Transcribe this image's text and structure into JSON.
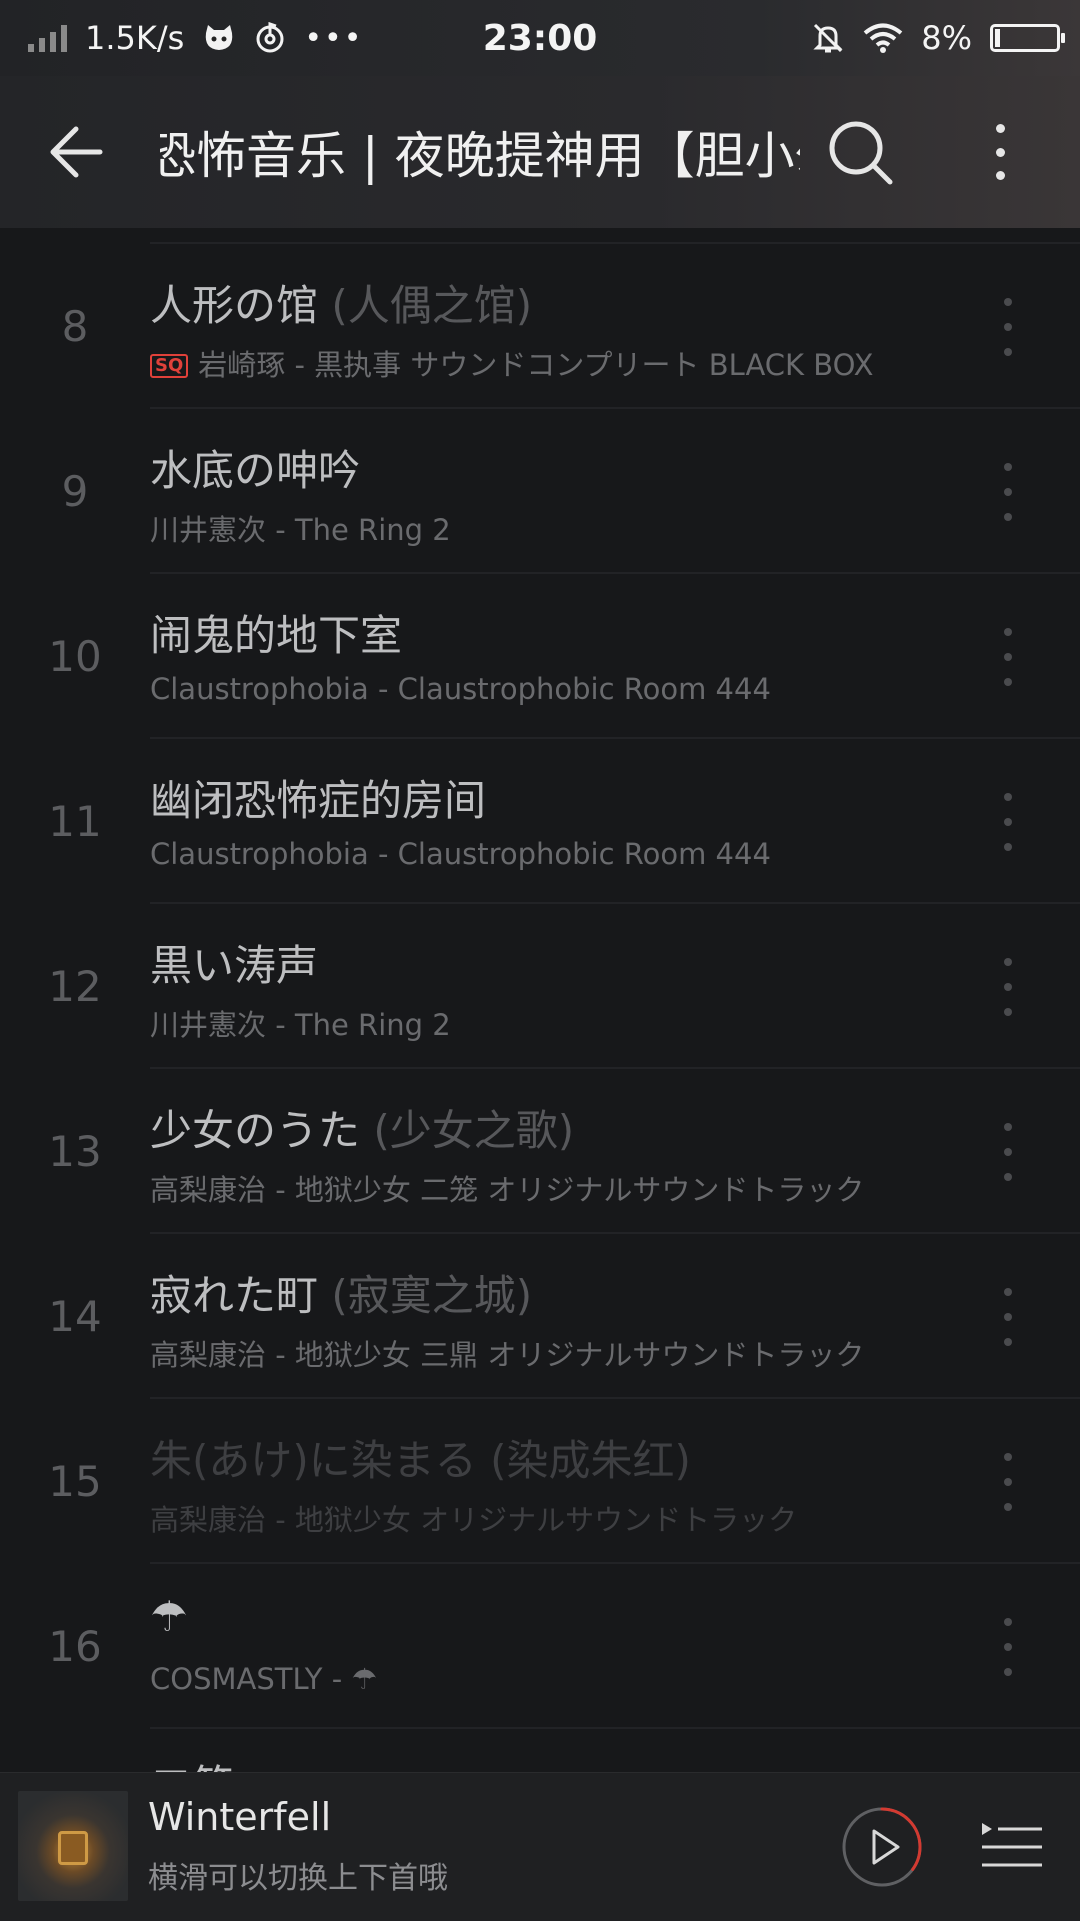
{
  "status": {
    "net_speed": "1.5K/s",
    "time": "23:00",
    "battery": "8%",
    "battery_level": 0.08
  },
  "header": {
    "title": "恐怖音乐 | 夜晚提神用【胆小勿入】"
  },
  "songs": [
    {
      "num": "8",
      "title": "人形の馆",
      "alias": "(人偶之馆)",
      "sq": "SQ",
      "sub": "岩崎琢 - 黒执事 サウンドコンプリート BLACK BOX"
    },
    {
      "num": "9",
      "title": "水底の呻吟",
      "alias": "",
      "sub": "川井憲次 - The Ring 2"
    },
    {
      "num": "10",
      "title": "闹鬼的地下室",
      "alias": "",
      "sub": "Claustrophobia - Claustrophobic Room 444"
    },
    {
      "num": "11",
      "title": "幽闭恐怖症的房间",
      "alias": "",
      "sub": "Claustrophobia - Claustrophobic Room 444"
    },
    {
      "num": "12",
      "title": "黒い涛声",
      "alias": "",
      "sub": "川井憲次 - The Ring 2"
    },
    {
      "num": "13",
      "title": "少女のうた",
      "alias": "(少女之歌)",
      "sub": "高梨康治 - 地狱少女 二笼 オリジナルサウンドトラック"
    },
    {
      "num": "14",
      "title": "寂れた町",
      "alias": "(寂寞之城)",
      "sub": "高梨康治 - 地狱少女 三鼎 オリジナルサウンドトラック"
    },
    {
      "num": "15",
      "title": "朱(あけ)に染まる",
      "alias": "(染成朱红)",
      "sub": "高梨康治 - 地狱少女 オリジナルサウンドトラック"
    },
    {
      "num": "16",
      "title": "☂",
      "alias": "",
      "sub": "COSMASTLY - ☂"
    }
  ],
  "next_peek": "二笼",
  "player": {
    "song": "Winterfell",
    "hint": "横滑可以切换上下首哦",
    "progress": 0.35,
    "accent": "#d33a31"
  },
  "icons": {
    "back": "arrow-left-icon",
    "search": "search-icon",
    "more": "more-vertical-icon",
    "play": "play-icon",
    "queue": "playlist-icon"
  }
}
